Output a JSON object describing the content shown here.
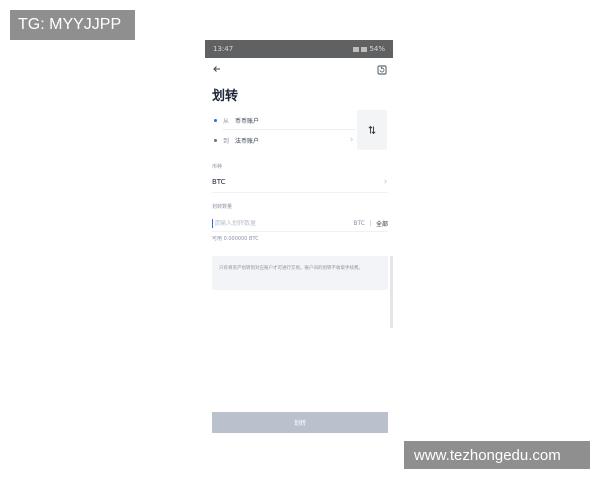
{
  "watermarks": {
    "top_left": "TG: MYYJJPP",
    "bottom_right": "www.tezhongedu.com"
  },
  "statusbar": {
    "time": "13:47",
    "indicators": "54%"
  },
  "topbar": {
    "back_icon": "arrow-left-icon",
    "history_icon": "record-list-icon"
  },
  "page": {
    "title": "划转"
  },
  "accounts": {
    "from_label": "从",
    "from_account": "币币账户",
    "to_label": "到",
    "to_account": "法币账户",
    "swap_icon": "swap-arrows-icon"
  },
  "coin": {
    "label": "币种",
    "value": "BTC"
  },
  "amount": {
    "label": "划转数量",
    "placeholder": "请输入划转数量",
    "unit": "BTC",
    "all_label": "全部",
    "available": "可用 0.000000 BTC"
  },
  "notice": {
    "text": "只有将资产划转到对应账户才可进行交易。账户间的划转不收取手续费。"
  },
  "submit": {
    "label": "划转"
  },
  "colors": {
    "accent": "#2b6fd6",
    "submit_disabled": "#b8c1cc",
    "statusbar": "#5f6163",
    "watermark": "#8f8f8f"
  }
}
